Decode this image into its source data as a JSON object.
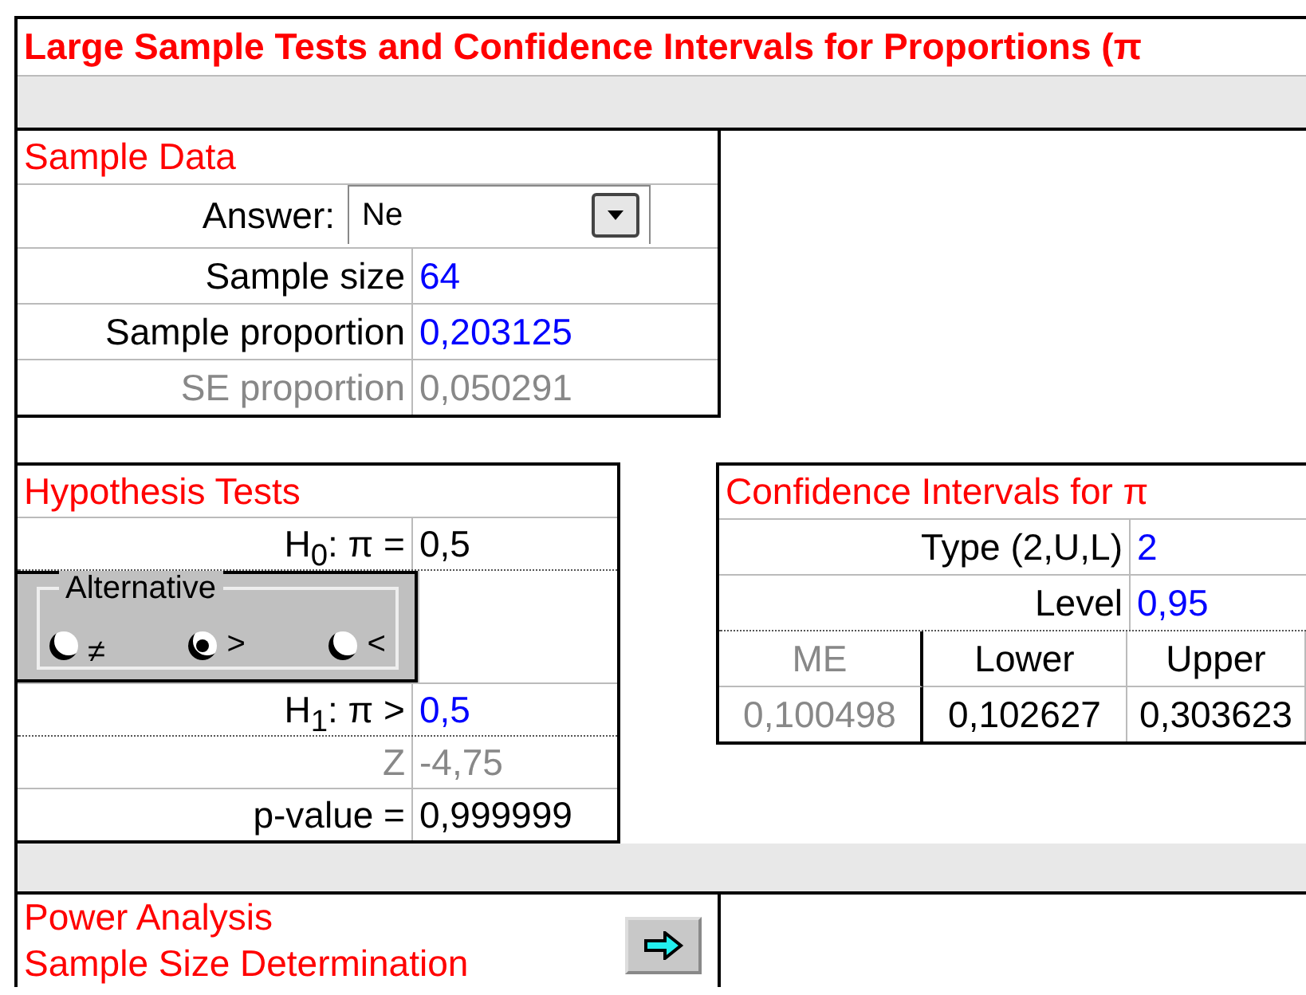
{
  "title": "Large Sample Tests and Confidence Intervals for Proportions (π",
  "sample_data": {
    "heading": "Sample Data",
    "answer": {
      "label": "Answer:",
      "value": "Ne"
    },
    "rows": [
      {
        "label": "Sample size",
        "value": "64",
        "kind": "input"
      },
      {
        "label": "Sample proportion",
        "value": "0,203125",
        "kind": "input"
      },
      {
        "label": "SE proportion",
        "value": "0,050291",
        "kind": "computed"
      }
    ]
  },
  "hypothesis_tests": {
    "heading": "Hypothesis Tests",
    "h0": {
      "label": "H$_{0}$: π =",
      "value": "0,5"
    },
    "alternative": {
      "legend": "Alternative",
      "options": [
        {
          "symbol": "≠",
          "selected": false
        },
        {
          "symbol": ">",
          "selected": true
        },
        {
          "symbol": "<",
          "selected": false
        }
      ]
    },
    "rows": [
      {
        "label": "H$_{1}$: π >",
        "value": "0,5",
        "kind": "input"
      },
      {
        "label": "Z",
        "value": "-4,75",
        "kind": "computed"
      },
      {
        "label": "p-value =",
        "value": "0,999999",
        "kind": "result"
      }
    ]
  },
  "confidence_intervals": {
    "heading": "Confidence Intervals for π",
    "rows": [
      {
        "label": "Type (2,U,L)",
        "value": "2",
        "kind": "input"
      },
      {
        "label": "Level",
        "value": "0,95",
        "kind": "input"
      }
    ],
    "columns": [
      {
        "heading": "ME",
        "value": "0,100498",
        "kind": "computed"
      },
      {
        "heading": "Lower",
        "value": "0,102627",
        "kind": "result"
      },
      {
        "heading": "Upper",
        "value": "0,303623",
        "kind": "result"
      }
    ]
  },
  "power": {
    "lines": [
      "Power Analysis",
      "Sample Size Determination"
    ]
  }
}
